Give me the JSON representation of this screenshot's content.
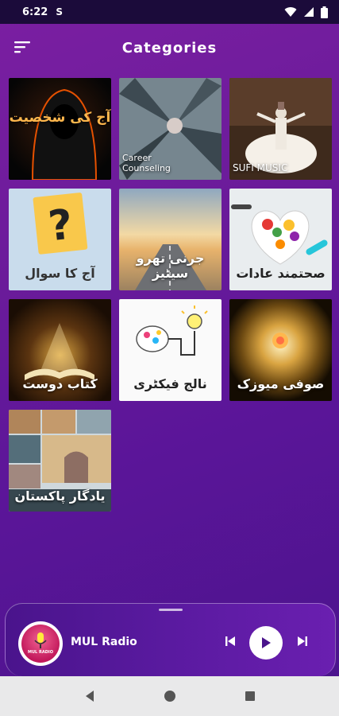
{
  "status_bar": {
    "time": "6:22",
    "sim_icon": "S"
  },
  "app_bar": {
    "title": "Categories"
  },
  "categories": [
    {
      "caption": "آج کی شخصیت",
      "image": "hooded-figure"
    },
    {
      "caption": "Career\nCounseling",
      "image": "stacked-hands"
    },
    {
      "caption": "SUFI MUSIC",
      "image": "whirling-dervish"
    },
    {
      "caption": "آج کا سوال",
      "image": "question-note"
    },
    {
      "caption": "جرنی تھرو سیٹیز",
      "image": "road-sunset"
    },
    {
      "caption": "صحتمند عادات",
      "image": "healthy-food"
    },
    {
      "caption": "کتاب دوست",
      "image": "open-book"
    },
    {
      "caption": "نالج فیکٹری",
      "image": "brain-bulb"
    },
    {
      "caption": "صوفی میوزک",
      "image": "glowing-rose"
    },
    {
      "caption": "یادگار پاکستان",
      "image": "pakistan-landmarks"
    }
  ],
  "player": {
    "station": "MUL Radio",
    "logo_text": "MUL RADIO"
  },
  "colors": {
    "background_top": "#7b1fa2",
    "background_bottom": "#4a148c",
    "status_bar": "#1b0b3a",
    "nav_bar": "#e9e9ea"
  }
}
